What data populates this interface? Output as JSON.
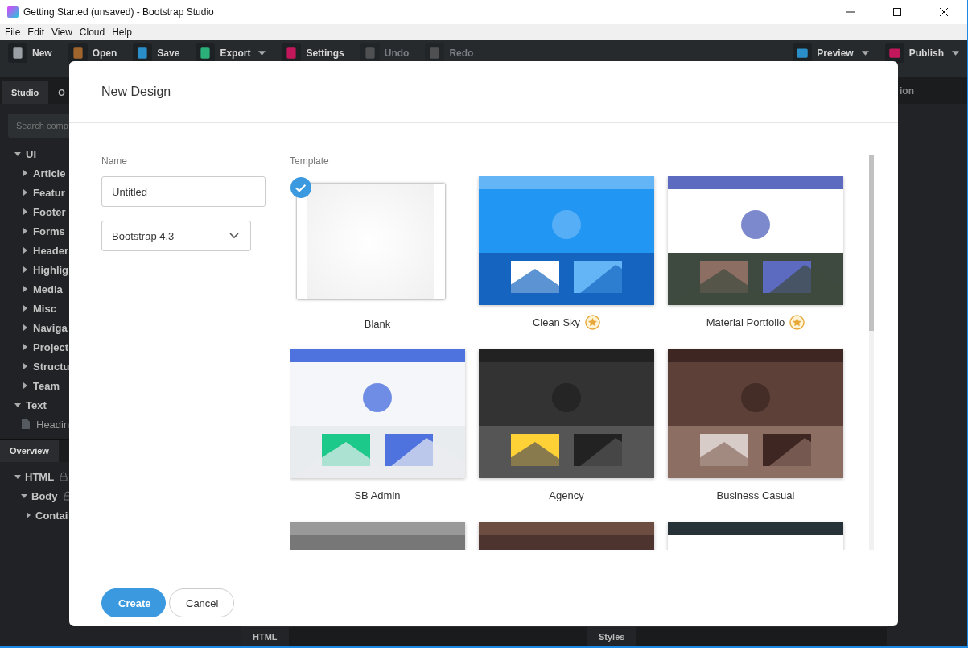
{
  "window": {
    "title": "Getting Started (unsaved) - Bootstrap Studio"
  },
  "menu": [
    "File",
    "Edit",
    "View",
    "Cloud",
    "Help"
  ],
  "toolbar": {
    "left": [
      {
        "label": "New",
        "dropdown": false,
        "disabled": false
      },
      {
        "label": "Open",
        "dropdown": false,
        "disabled": false
      },
      {
        "label": "Save",
        "dropdown": false,
        "disabled": false
      },
      {
        "label": "Export",
        "dropdown": true,
        "disabled": false
      },
      {
        "label": "Settings",
        "dropdown": false,
        "disabled": false
      },
      {
        "label": "Undo",
        "dropdown": false,
        "disabled": true
      },
      {
        "label": "Redo",
        "dropdown": false,
        "disabled": true
      }
    ],
    "right": [
      {
        "label": "Preview",
        "dropdown": true,
        "disabled": false
      },
      {
        "label": "Publish",
        "dropdown": true,
        "disabled": false
      }
    ]
  },
  "left_panel": {
    "tabs": [
      {
        "label": "Studio",
        "selected": true
      },
      {
        "label": "O",
        "selected": false
      }
    ],
    "search": {
      "placeholder": "Search comp"
    },
    "tree": [
      {
        "label": "UI",
        "expanded": true,
        "children": [
          {
            "label": "Article",
            "expanded": false
          },
          {
            "label": "Featur",
            "expanded": false
          },
          {
            "label": "Footer",
            "expanded": false
          },
          {
            "label": "Forms",
            "expanded": false
          },
          {
            "label": "Header",
            "expanded": false
          },
          {
            "label": "Highlig",
            "expanded": false
          },
          {
            "label": "Media",
            "expanded": false
          },
          {
            "label": "Misc",
            "expanded": false
          },
          {
            "label": "Naviga",
            "expanded": false
          },
          {
            "label": "Project",
            "expanded": false
          },
          {
            "label": "Structu",
            "expanded": false
          },
          {
            "label": "Team",
            "expanded": false
          }
        ]
      },
      {
        "label": "Text",
        "expanded": true,
        "children": [
          {
            "label": "Headin",
            "kind": "leaf"
          }
        ]
      }
    ]
  },
  "overview": {
    "tab": "Overview",
    "tree": [
      {
        "label": "HTML",
        "expanded": true,
        "locked": true,
        "children": [
          {
            "label": "Body",
            "expanded": true,
            "locked": true,
            "children": [
              {
                "label": "Contai",
                "expanded": false
              }
            ]
          }
        ]
      }
    ]
  },
  "right_panel": {
    "tab": "ion"
  },
  "bottom_tabs": [
    "HTML",
    "Styles"
  ],
  "dialog": {
    "title": "New Design",
    "name_label": "Name",
    "name_value": "Untitled",
    "version": "Bootstrap 4.3",
    "template_label": "Template",
    "templates": [
      {
        "name": "Blank",
        "kind": "blank",
        "selected": true,
        "premium": false
      },
      {
        "name": "Clean Sky",
        "kind": "picture",
        "selected": false,
        "premium": true
      },
      {
        "name": "Material Portfolio",
        "kind": "picture",
        "selected": false,
        "premium": true
      },
      {
        "name": "SB Admin",
        "kind": "picture",
        "selected": false,
        "premium": false
      },
      {
        "name": "Agency",
        "kind": "picture",
        "selected": false,
        "premium": false
      },
      {
        "name": "Business Casual",
        "kind": "picture",
        "selected": false,
        "premium": false
      },
      {
        "kind": "picture",
        "selected": false
      },
      {
        "kind": "picture",
        "selected": false
      },
      {
        "kind": "picture",
        "selected": false
      }
    ],
    "buttons": [
      {
        "label": "Create",
        "kind": "primary"
      },
      {
        "label": "Cancel",
        "kind": "secondary"
      }
    ]
  }
}
